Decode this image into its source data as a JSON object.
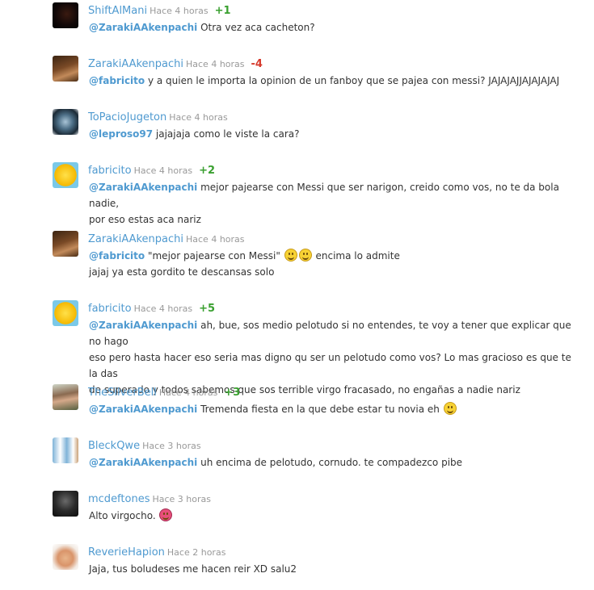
{
  "comments": [
    {
      "user": "ShiftAlMani",
      "time": "Hace 4 horas",
      "score": "+1",
      "mention": "@ZarakiAAkenpachi",
      "text": " Otra vez aca cacheton?"
    },
    {
      "user": "ZarakiAAkenpachi",
      "time": "Hace 4 horas",
      "score": "-4",
      "mention": "@fabricito",
      "text": " y a quien le importa la opinion de un fanboy que se pajea con messi? JAJAJAJJAJAJAJAJ"
    },
    {
      "user": "ToPacioJugeton",
      "time": "Hace 4 horas",
      "mention": "@leproso97",
      "text": " jajajaja como le viste la cara?"
    },
    {
      "user": "fabricito",
      "time": "Hace 4 horas",
      "score": "+2",
      "mention": "@ZarakiAAkenpachi",
      "text": " mejor pajearse con Messi que ser narigon, creido como vos, no te da bola nadie,",
      "line2": "por eso estas aca nariz"
    },
    {
      "user": "ZarakiAAkenpachi",
      "time": "Hace 4 horas",
      "mention": "@fabricito",
      "text": " \"mejor pajearse con Messi\" ",
      "text_after": " encima lo admite",
      "line2": "jajaj ya esta gordito te descansas solo"
    },
    {
      "user": "fabricito",
      "time": "Hace 4 horas",
      "score": "+5",
      "mention": "@ZarakiAAkenpachi",
      "text": " ah, bue, sos medio pelotudo si no entendes, te voy a tener que explicar que no hago",
      "line2": "eso pero hasta hacer eso seria mas digno qu ser un pelotudo como vos? Lo mas gracioso es que te la das",
      "line3": "de superado y todos sabemos que sos terrible virgo fracasado, no engañas a nadie nariz"
    },
    {
      "user": "TheSilverBell",
      "time": "Hace 4 horas",
      "score": "+3",
      "mention": "@ZarakiAAkenpachi",
      "text": " Tremenda fiesta en la que debe estar tu novia eh "
    },
    {
      "user": "BleckQwe",
      "time": "Hace 3 horas",
      "mention": "@ZarakiAAkenpachi",
      "text": " uh encima de pelotudo, cornudo. te compadezco pibe"
    },
    {
      "user": "mcdeftones",
      "time": "Hace 3 horas",
      "text": "Alto virgocho. "
    },
    {
      "user": "ReverieHapion",
      "time": "Hace 2 horas",
      "text": "Jaja, tus boludeses me hacen reir XD salu2"
    }
  ]
}
